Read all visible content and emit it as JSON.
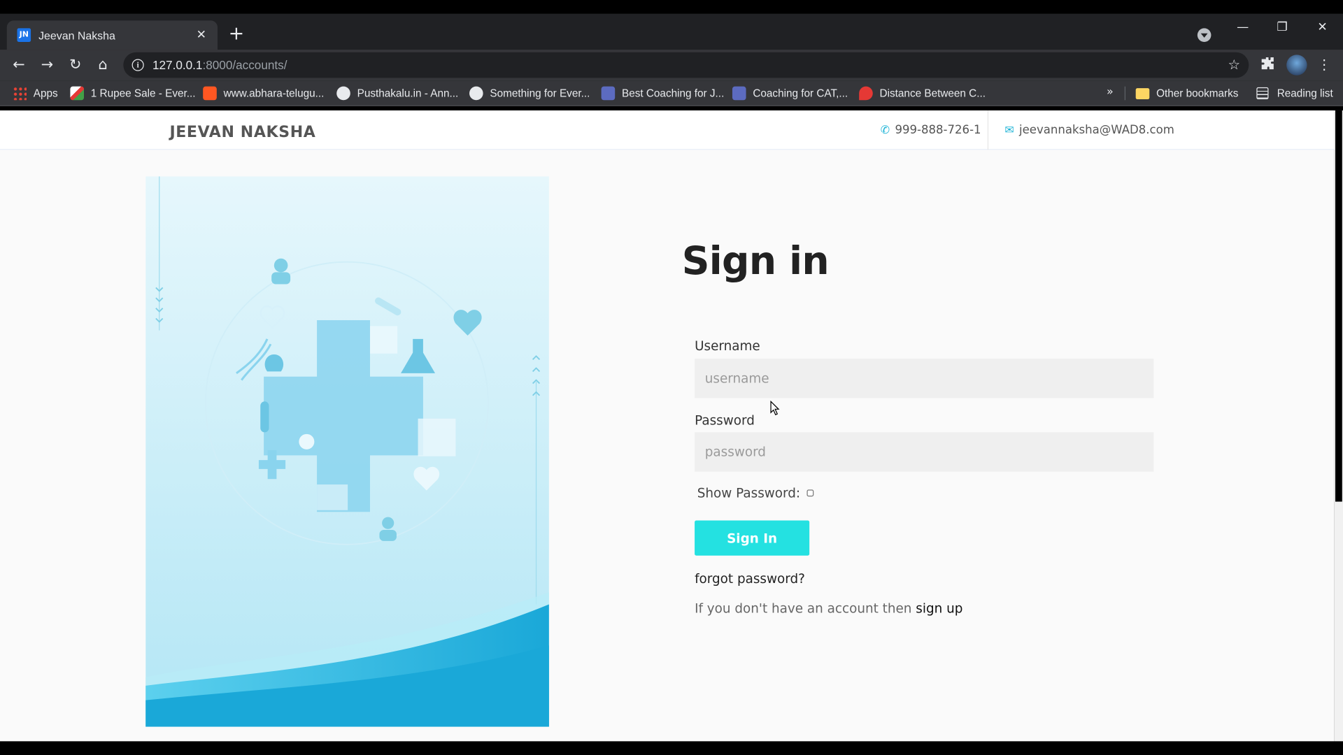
{
  "browser": {
    "tab_title": "Jeevan Naksha",
    "tab_favicon_text": "JN",
    "url_host": "127.0.0.1",
    "url_path": ":8000/accounts/",
    "bookmarks": [
      {
        "label": "Apps",
        "icon": "apps-grid-icon"
      },
      {
        "label": "1 Rupee Sale - Ever...",
        "icon": "sale-icon",
        "color": "#e0e0e0"
      },
      {
        "label": "www.abhara-telugu...",
        "icon": "blogger-icon",
        "color": "#ff5722"
      },
      {
        "label": "Pusthakalu.in - Ann...",
        "icon": "globe-icon",
        "color": "#e8eaed"
      },
      {
        "label": "Something for Ever...",
        "icon": "globe-icon",
        "color": "#e8eaed"
      },
      {
        "label": "Best Coaching for J...",
        "icon": "coaching-icon",
        "color": "#5c6bc0"
      },
      {
        "label": "Coaching for CAT,...",
        "icon": "coaching-icon",
        "color": "#5c6bc0"
      },
      {
        "label": "Distance Between C...",
        "icon": "rocket-icon",
        "color": "#e53935"
      }
    ],
    "overflow_label": "»",
    "other_bookmarks": "Other bookmarks",
    "reading_list": "Reading list"
  },
  "header": {
    "brand": "JEEVAN NAKSHA",
    "phone": "999-888-726-1",
    "email": "jeevannaksha@WAD8.com"
  },
  "form": {
    "title": "Sign in",
    "username_label": "Username",
    "username_placeholder": "username",
    "password_label": "Password",
    "password_placeholder": "password",
    "show_password_label": "Show Password:",
    "submit_label": "Sign In",
    "forgot_label": "forgot password?",
    "signup_prefix": "If you don't have an account then ",
    "signup_link": "sign up"
  },
  "colors": {
    "accent": "#24e1e1",
    "brand_text": "#555555",
    "illustration_light": "#e6f7fc",
    "illustration_dark": "#1aa8d8"
  }
}
